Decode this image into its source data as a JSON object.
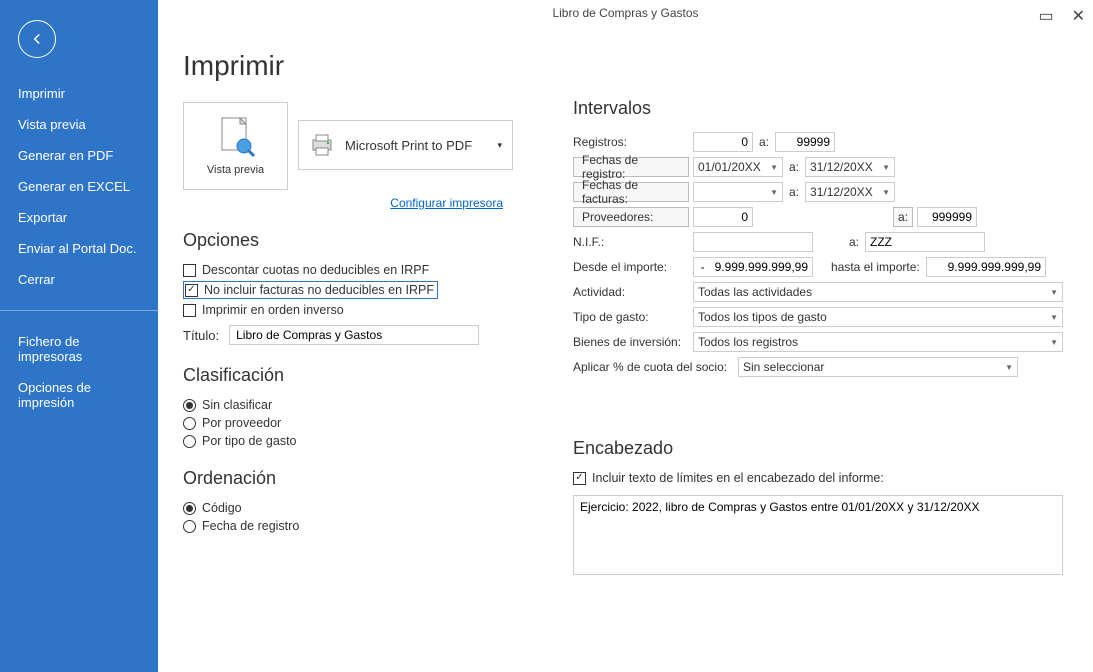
{
  "window": {
    "title": "Libro de Compras y Gastos"
  },
  "sidebar": {
    "items": [
      "Imprimir",
      "Vista previa",
      "Generar en PDF",
      "Generar en EXCEL",
      "Exportar",
      "Enviar al Portal Doc.",
      "Cerrar"
    ],
    "items2": [
      "Fichero de impresoras",
      "Opciones de impresión"
    ]
  },
  "print": {
    "heading": "Imprimir",
    "preview_label": "Vista previa",
    "printer": "Microsoft Print to PDF",
    "config_link": "Configurar impresora",
    "options_heading": "Opciones",
    "opt1": "Descontar cuotas no deducibles en IRPF",
    "opt2": "No incluir facturas no deducibles en IRPF",
    "opt3": "Imprimir en orden inverso",
    "title_label": "Título:",
    "title_value": "Libro de Compras y Gastos",
    "classif_heading": "Clasificación",
    "c1": "Sin clasificar",
    "c2": "Por proveedor",
    "c3": "Por tipo de gasto",
    "order_heading": "Ordenación",
    "o1": "Código",
    "o2": "Fecha de registro"
  },
  "intervals": {
    "heading": "Intervalos",
    "registros_label": "Registros:",
    "reg_from": "0",
    "a": "a:",
    "reg_to": "99999",
    "fechas_reg_label": "Fechas de registro:",
    "freg_from": "01/01/20XX",
    "freg_to": "31/12/20XX",
    "fechas_fact_label": "Fechas de facturas:",
    "ffac_from": "",
    "ffac_to": "31/12/20XX",
    "prov_label": "Proveedores:",
    "prov_from": "0",
    "prov_to": "999999",
    "nif_label": "N.I.F.:",
    "nif_from": "",
    "nif_to": "ZZZ",
    "desde_imp": "Desde el importe:",
    "imp_from": "-   9.999.999.999,99",
    "hasta_imp": "hasta el importe:",
    "imp_to": "9.999.999.999,99",
    "actividad_label": "Actividad:",
    "actividad": "Todas las actividades",
    "tipo_label": "Tipo de gasto:",
    "tipo": "Todos los tipos de gasto",
    "bienes_label": "Bienes de inversión:",
    "bienes": "Todos los registros",
    "cuota_label": "Aplicar % de cuota del socio:",
    "cuota": "Sin seleccionar"
  },
  "header": {
    "heading": "Encabezado",
    "chk_label": "Incluir texto de límites en el encabezado del informe:",
    "text": "Ejercicio: 2022, libro de Compras y Gastos entre 01/01/20XX y 31/12/20XX"
  }
}
